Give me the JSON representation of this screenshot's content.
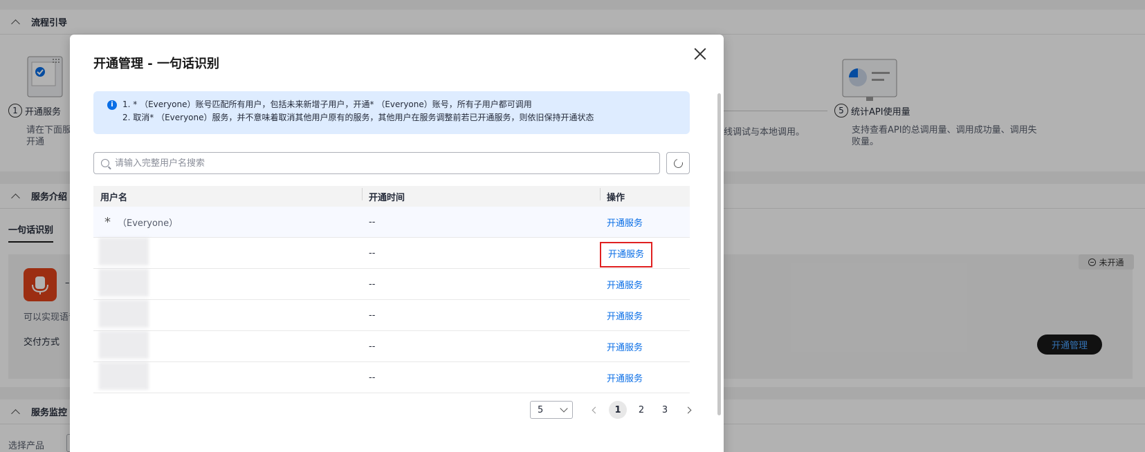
{
  "background": {
    "guide_section": "流程引导",
    "step1_label": "开通服务",
    "step1_num": "1",
    "step1_desc_1": "请在下面服",
    "step1_desc_2": "开通",
    "step_mid_desc": "线调试与本地调用。",
    "step5_num": "5",
    "step5_label": "统计API使用量",
    "step5_desc_1": "支持查看API的总调用量、调用成功量、调用失",
    "step5_desc_2": "败量。",
    "intro_section": "服务介绍",
    "intro_tab": "一句话识别",
    "intro_dash": "–",
    "intro_desc": "可以实现语音",
    "delivery_label": "交付方式",
    "status_pill": "未开通",
    "manage_button": "开通管理",
    "monitor_section": "服务监控",
    "select_product": "选择产品"
  },
  "modal": {
    "title": "开通管理 - 一句话识别",
    "alert_line1": "1. * （Everyone）账号匹配所有用户，包括未来新增子用户，开通* （Everyone）账号，所有子用户都可调用",
    "alert_line2": "2. 取消* （Everyone）服务，并不意味着取消其他用户原有的服务，其他用户在服务调整前若已开通服务，则依旧保持开通状态",
    "search_placeholder": "请输入完整用户名搜索",
    "columns": [
      "用户名",
      "开通时间",
      "操作"
    ],
    "rows": [
      {
        "star": "*",
        "user": "（Everyone）",
        "time": "--",
        "action": "开通服务"
      },
      {
        "user": "",
        "time": "--",
        "action": "开通服务"
      },
      {
        "user": "",
        "time": "--",
        "action": "开通服务"
      },
      {
        "user": "",
        "time": "--",
        "action": "开通服务"
      },
      {
        "user": "",
        "time": "--",
        "action": "开通服务"
      },
      {
        "user": "",
        "time": "--",
        "action": "开通服务"
      }
    ],
    "pagination": {
      "page_size": "5",
      "pages": [
        "1",
        "2",
        "3"
      ],
      "current": "1"
    }
  }
}
